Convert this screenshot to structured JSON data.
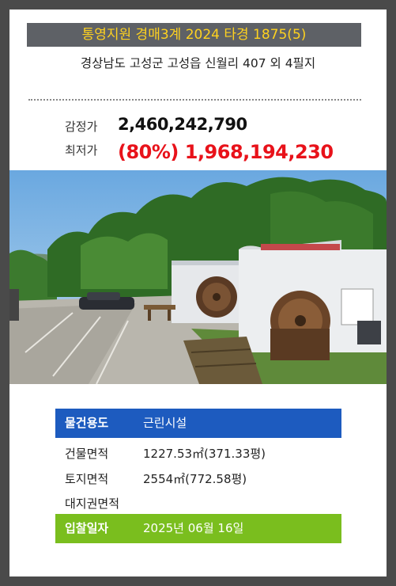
{
  "header": {
    "title": "통영지원 경매3계 2024 타경 1875(5)"
  },
  "property": {
    "address": "경상남도 고성군 고성읍 신월리 407 외 4필지"
  },
  "prices": {
    "appraisal_label": "감정가",
    "appraisal_value": "2,460,242,790",
    "minimum_label": "최저가",
    "minimum_value": "(80%) 1,968,194,230"
  },
  "details": {
    "usage_label": "물건용도",
    "usage_value": "근린시설",
    "building_area_label": "건물면적",
    "building_area_value": "1227.53㎡(371.33평)",
    "land_area_label": "토지면적",
    "land_area_value": "2554㎡(772.58평)",
    "land_right_label": "대지권면적",
    "land_right_value": "",
    "bid_date_label": "입찰일자",
    "bid_date_value": "2025년 06월 16일"
  },
  "colors": {
    "title_bg": "#5e6166",
    "title_text": "#ffd21f",
    "minimum_price": "#e8121a",
    "usage_bg": "#1d5bbf",
    "bid_date_bg": "#7abe1e"
  }
}
